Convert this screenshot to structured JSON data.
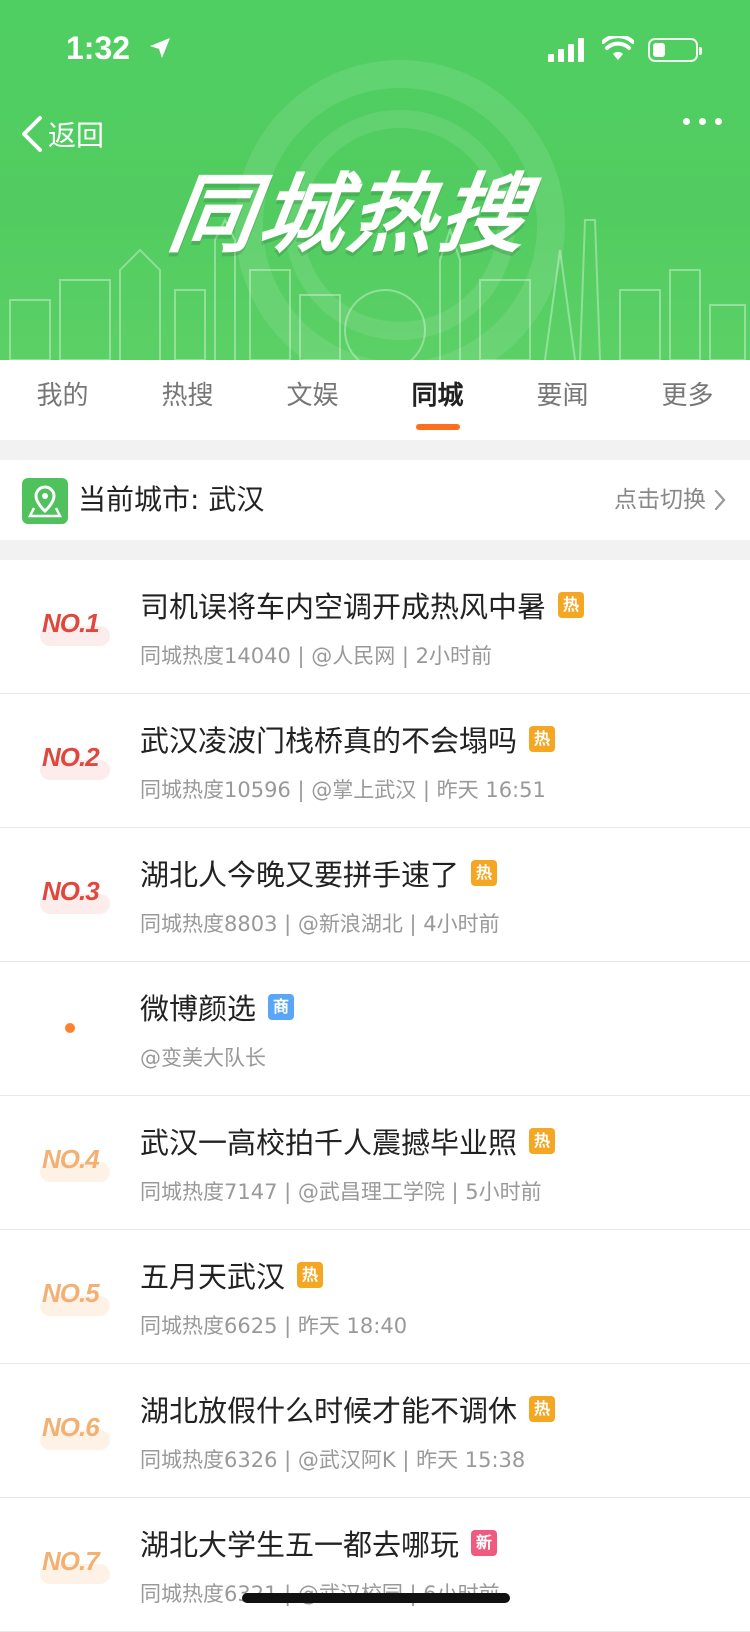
{
  "status": {
    "time": "1:32"
  },
  "nav": {
    "back_label": "返回"
  },
  "banner": {
    "title": "同城热搜"
  },
  "tabs": [
    {
      "label": "我的",
      "active": false
    },
    {
      "label": "热搜",
      "active": false
    },
    {
      "label": "文娱",
      "active": false
    },
    {
      "label": "同城",
      "active": true
    },
    {
      "label": "要闻",
      "active": false
    },
    {
      "label": "更多",
      "active": false
    }
  ],
  "city": {
    "label": "当前城市: 武汉",
    "switch_label": "点击切换"
  },
  "items": [
    {
      "rank": "NO.1",
      "rank_style": "red",
      "title": "司机误将车内空调开成热风中暑",
      "badge": "热",
      "badge_color": "#f5a623",
      "meta": "同城热度14040 | @人民网 | 2小时前"
    },
    {
      "rank": "NO.2",
      "rank_style": "red",
      "title": "武汉凌波门栈桥真的不会塌吗",
      "badge": "热",
      "badge_color": "#f5a623",
      "meta": "同城热度10596 | @掌上武汉 | 昨天 16:51"
    },
    {
      "rank": "NO.3",
      "rank_style": "red",
      "title": "湖北人今晚又要拼手速了",
      "badge": "热",
      "badge_color": "#f5a623",
      "meta": "同城热度8803 | @新浪湖北 | 4小时前"
    },
    {
      "rank": "",
      "rank_style": "dot",
      "title": "微博颜选",
      "badge": "商",
      "badge_color": "#5aa5f5",
      "meta": "@变美大队长"
    },
    {
      "rank": "NO.4",
      "rank_style": "org",
      "title": "武汉一高校拍千人震撼毕业照",
      "badge": "热",
      "badge_color": "#f5a623",
      "meta": "同城热度7147 | @武昌理工学院 | 5小时前"
    },
    {
      "rank": "NO.5",
      "rank_style": "org",
      "title": "五月天武汉",
      "badge": "热",
      "badge_color": "#f5a623",
      "meta": "同城热度6625 | 昨天 18:40"
    },
    {
      "rank": "NO.6",
      "rank_style": "org",
      "title": "湖北放假什么时候才能不调休",
      "badge": "热",
      "badge_color": "#f5a623",
      "meta": "同城热度6326 | @武汉阿K | 昨天 15:38"
    },
    {
      "rank": "NO.7",
      "rank_style": "org",
      "title": "湖北大学生五一都去哪玩",
      "badge": "新",
      "badge_color": "#f05a7e",
      "meta": "同城热度6321 | @武汉校园 | 6小时前"
    }
  ]
}
